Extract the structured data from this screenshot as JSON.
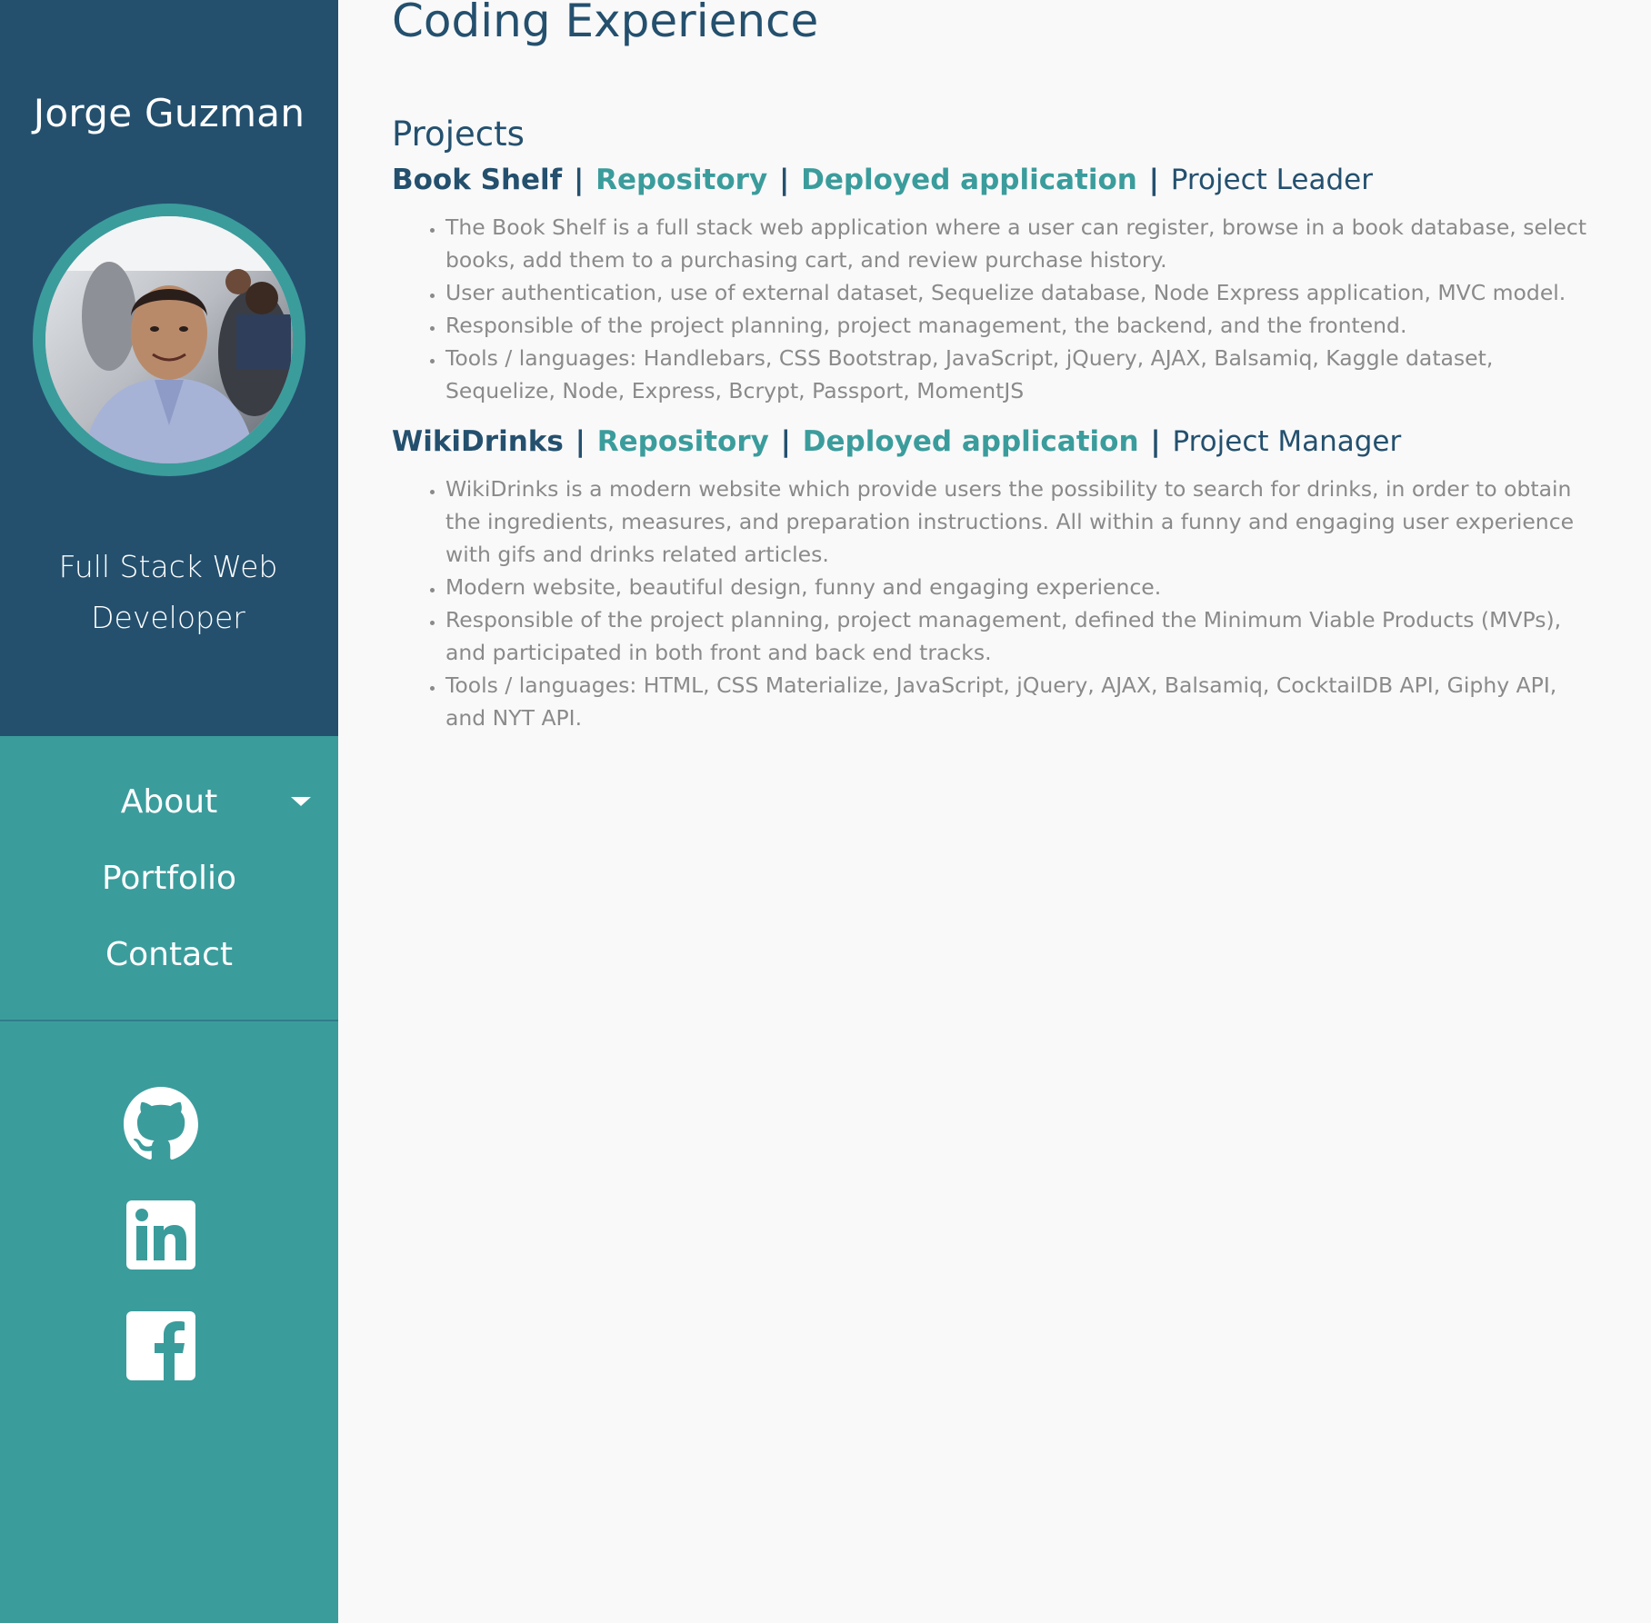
{
  "sidebar": {
    "name": "Jorge Guzman",
    "role": "Full Stack Web Developer",
    "nav": [
      "About",
      "Portfolio",
      "Contact"
    ],
    "social": [
      "github-icon",
      "linkedin-icon",
      "facebook-icon"
    ],
    "colors": {
      "top": "#24506e",
      "bottom": "#3b9c9c"
    }
  },
  "main": {
    "title": "Coding Experience",
    "section": "Projects",
    "projects": [
      {
        "name": "Book Shelf",
        "repo_label": "Repository",
        "deploy_label": "Deployed application",
        "role": "Project Leader",
        "bullets": [
          "The Book Shelf is a full stack web application where a user can register, browse in a book database, select books, add them to a purchasing cart, and review purchase history.",
          "User authentication, use of external dataset, Sequelize database, Node Express application, MVC model.",
          "Responsible of the project planning, project management, the backend, and the frontend.",
          "Tools / languages: Handlebars, CSS Bootstrap, JavaScript, jQuery, AJAX, Balsamiq, Kaggle dataset, Sequelize, Node, Express, Bcrypt, Passport, MomentJS"
        ]
      },
      {
        "name": "WikiDrinks",
        "repo_label": "Repository",
        "deploy_label": "Deployed application",
        "role": "Project Manager",
        "bullets": [
          "WikiDrinks is a modern website which provide users the possibility to search for drinks, in order to obtain the ingredients, measures, and preparation instructions. All within a funny and engaging user experience with gifs and drinks related articles.",
          "Modern website, beautiful design, funny and engaging experience.",
          "Responsible of the project planning, project management, defined the Minimum Viable Products (MVPs), and participated in both front and back end tracks.",
          "Tools / languages: HTML, CSS Materialize, JavaScript, jQuery, AJAX, Balsamiq, CocktailDB API, Giphy API, and NYT API."
        ]
      }
    ],
    "colors": {
      "heading": "#24506e",
      "link": "#3b9c9c",
      "text": "#8a8a8a"
    }
  }
}
